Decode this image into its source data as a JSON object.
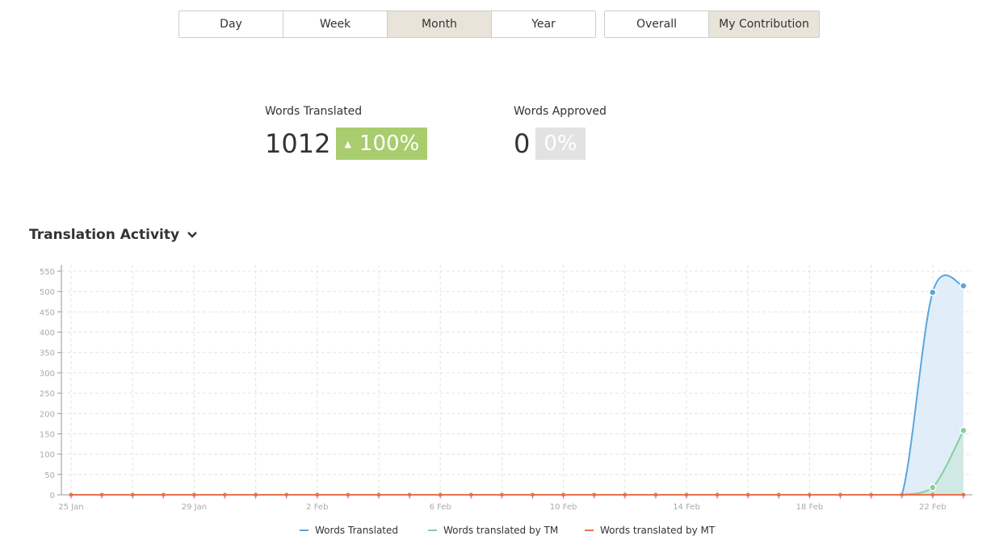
{
  "period_tabs": [
    {
      "label": "Day"
    },
    {
      "label": "Week"
    },
    {
      "label": "Month",
      "active": true
    },
    {
      "label": "Year"
    }
  ],
  "scope_tabs": [
    {
      "label": "Overall"
    },
    {
      "label": "My Contribution",
      "active": true
    }
  ],
  "stats": {
    "translated": {
      "label": "Words Translated",
      "value": "1012",
      "change": "100%",
      "change_icon": "triangle-up-icon",
      "color": "#a9cd6e"
    },
    "approved": {
      "label": "Words Approved",
      "value": "0",
      "change": "0%",
      "color": "#e2e2e2"
    }
  },
  "section_title": "Translation Activity",
  "chart_data": {
    "type": "area",
    "x": [
      "25 Jan",
      "26 Jan",
      "27 Jan",
      "28 Jan",
      "29 Jan",
      "30 Jan",
      "31 Jan",
      "1 Feb",
      "2 Feb",
      "3 Feb",
      "4 Feb",
      "5 Feb",
      "6 Feb",
      "7 Feb",
      "8 Feb",
      "9 Feb",
      "10 Feb",
      "11 Feb",
      "12 Feb",
      "13 Feb",
      "14 Feb",
      "15 Feb",
      "16 Feb",
      "17 Feb",
      "18 Feb",
      "19 Feb",
      "20 Feb",
      "21 Feb",
      "22 Feb",
      "23 Feb"
    ],
    "xtick_labels": [
      "25 Jan",
      "29 Jan",
      "2 Feb",
      "6 Feb",
      "10 Feb",
      "14 Feb",
      "18 Feb",
      "22 Feb"
    ],
    "yticks": [
      0,
      50,
      100,
      150,
      200,
      250,
      300,
      350,
      400,
      450,
      500,
      550
    ],
    "ylim": [
      0,
      560
    ],
    "grid": true,
    "legend": "bottom",
    "series": [
      {
        "name": "Words Translated",
        "color": "#5aa6de",
        "fill": "#dcebf8",
        "values": [
          0,
          0,
          0,
          0,
          0,
          0,
          0,
          0,
          0,
          0,
          0,
          0,
          0,
          0,
          0,
          0,
          0,
          0,
          0,
          0,
          0,
          0,
          0,
          0,
          0,
          0,
          0,
          0,
          498,
          514
        ]
      },
      {
        "name": "Words translated by TM",
        "color": "#86cfa0",
        "fill": "#cde8e0",
        "values": [
          0,
          0,
          0,
          0,
          0,
          0,
          0,
          0,
          0,
          0,
          0,
          0,
          0,
          0,
          0,
          0,
          0,
          0,
          0,
          0,
          0,
          0,
          0,
          0,
          0,
          0,
          0,
          0,
          18,
          158
        ]
      },
      {
        "name": "Words translated by MT",
        "color": "#e8734a",
        "fill": "#f3c9b5",
        "values": [
          0,
          0,
          0,
          0,
          0,
          0,
          0,
          0,
          0,
          0,
          0,
          0,
          0,
          0,
          0,
          0,
          0,
          0,
          0,
          0,
          0,
          0,
          0,
          0,
          0,
          0,
          0,
          0,
          0,
          0
        ]
      }
    ]
  }
}
